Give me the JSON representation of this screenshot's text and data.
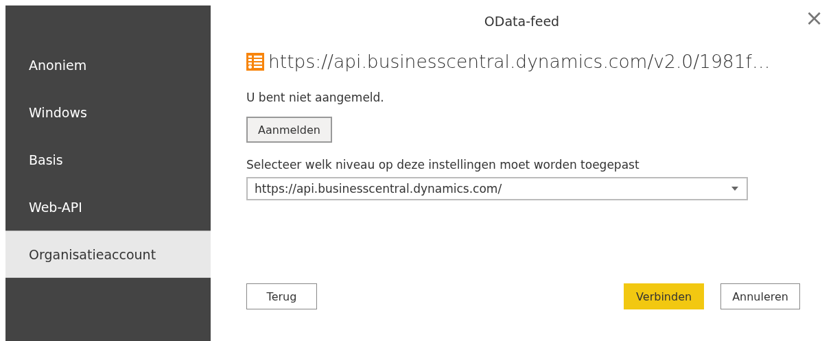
{
  "sidebar": {
    "items": [
      {
        "label": "Anoniem",
        "selected": false
      },
      {
        "label": "Windows",
        "selected": false
      },
      {
        "label": "Basis",
        "selected": false
      },
      {
        "label": "Web-API",
        "selected": false
      },
      {
        "label": "Organisatieaccount",
        "selected": true
      }
    ]
  },
  "dialog": {
    "title": "OData-feed",
    "close": "×",
    "url": "https://api.businesscentral.dynamics.com/v2.0/1981f…",
    "status": "U bent niet aangemeld.",
    "sign_in_button": "Aanmelden",
    "level_label": "Selecteer welk niveau op deze instellingen moet worden toegepast",
    "level_select": {
      "value": "https://api.businesscentral.dynamics.com/"
    }
  },
  "buttons": [
    {
      "label": "Terug",
      "kind": "secondary"
    },
    {
      "label": "Verbinden",
      "kind": "primary"
    },
    {
      "label": "Annuleren",
      "kind": "secondary"
    }
  ]
}
